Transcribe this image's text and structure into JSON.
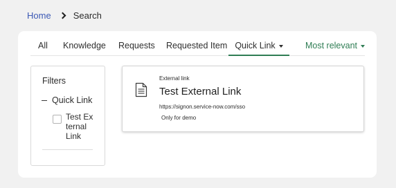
{
  "breadcrumb": {
    "home": "Home",
    "current": "Search"
  },
  "tabs": [
    {
      "label": "All",
      "active": false
    },
    {
      "label": "Knowledge",
      "active": false
    },
    {
      "label": "Requests",
      "active": false
    },
    {
      "label": "Requested Item",
      "active": false
    },
    {
      "label": "Quick Link",
      "active": true
    }
  ],
  "sort": {
    "label": "Most relevant"
  },
  "filters": {
    "title": "Filters",
    "group_label": "Quick Link",
    "option_label": "Test External Link",
    "option_checked": false
  },
  "result": {
    "type": "External link",
    "title": "Test External Link",
    "url": "https://signon.service-now.com/sso",
    "description": "Only for demo"
  },
  "colors": {
    "link": "#3c59b5",
    "accent": "#2f7d54",
    "background": "#f1f1f1"
  },
  "icons": {
    "breadcrumb_separator": "chevron-right-icon",
    "tab_dropdown": "caret-down-icon",
    "sort_dropdown": "caret-down-icon",
    "filter_collapse": "minus-icon",
    "result": "document-icon"
  }
}
